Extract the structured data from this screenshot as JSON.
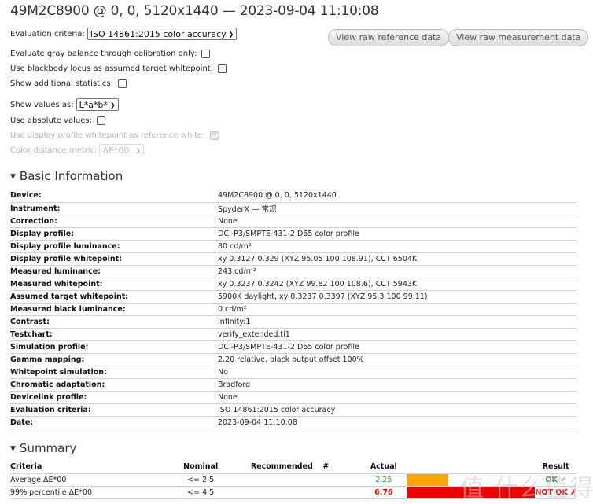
{
  "title": "49M2C8900 @ 0, 0, 5120x1440 — 2023-09-04 11:10:08",
  "options": {
    "evaluation_criteria_label": "Evaluation criteria:",
    "evaluation_criteria_value": "ISO 14861:2015 color accuracy",
    "gray_balance_label": "Evaluate gray balance through calibration only:",
    "blackbody_label": "Use blackbody locus as assumed target whitepoint:",
    "additional_stats_label": "Show additional statistics:",
    "show_values_label": "Show values as:",
    "show_values_value": "L*a*b*",
    "absolute_values_label": "Use absolute values:",
    "display_whitepoint_label": "Use display profile whitepoint as reference white:",
    "color_distance_label": "Color distance metric:",
    "color_distance_value": "ΔE*00"
  },
  "buttons": {
    "raw_reference": "View raw reference data",
    "raw_measurement": "View raw measurement data"
  },
  "basic_info": {
    "heading": "Basic Information",
    "rows": [
      {
        "key": "Device:",
        "value": "49M2C8900 @ 0, 0, 5120x1440"
      },
      {
        "key": "Instrument:",
        "value": "SpyderX — 常规"
      },
      {
        "key": "Correction:",
        "value": "None"
      },
      {
        "key": "Display profile:",
        "value": "DCI-P3/SMPTE-431-2 D65 color profile"
      },
      {
        "key": "Display profile luminance:",
        "value": "80 cd/m²"
      },
      {
        "key": "Display profile whitepoint:",
        "value": "xy 0.3127 0.329 (XYZ 95.05 100 108.91), CCT 6504K"
      },
      {
        "key": "Measured luminance:",
        "value": "243 cd/m²"
      },
      {
        "key": "Measured whitepoint:",
        "value": "xy 0.3237 0.3242 (XYZ 99.82 100 108.6), CCT 5943K"
      },
      {
        "key": "Assumed target whitepoint:",
        "value": "5900K daylight, xy 0.3237 0.3397 (XYZ 95.3 100 99.11)"
      },
      {
        "key": "Measured black luminance:",
        "value": "0 cd/m²"
      },
      {
        "key": "Contrast:",
        "value": "Infinity:1"
      },
      {
        "key": "Testchart:",
        "value": "verify_extended.ti1"
      },
      {
        "key": "Simulation profile:",
        "value": "DCI-P3/SMPTE-431-2 D65 color profile"
      },
      {
        "key": "Gamma mapping:",
        "value": "2.20 relative, black output offset 100%"
      },
      {
        "key": "Whitepoint simulation:",
        "value": "No"
      },
      {
        "key": "Chromatic adaptation:",
        "value": "Bradford"
      },
      {
        "key": "Devicelink profile:",
        "value": "None"
      },
      {
        "key": "Evaluation criteria:",
        "value": "ISO 14861:2015 color accuracy"
      },
      {
        "key": "Date:",
        "value": "2023-09-04 11:10:08"
      }
    ]
  },
  "summary": {
    "heading": "Summary",
    "headers": {
      "criteria": "Criteria",
      "nominal": "Nominal",
      "recommended": "Recommended",
      "hash": "#",
      "actual": "Actual",
      "result": "Result"
    },
    "rows": [
      {
        "criteria": "Average ΔE*00",
        "nominal": "<= 2.5",
        "recommended": "",
        "hash": "",
        "actual": "2.25",
        "actual_color": "#3a9a3a",
        "bar_color": "#ffa500",
        "bar_fraction": 0.22,
        "result": "OK ✓",
        "result_color": "#3a9a3a"
      },
      {
        "criteria": "99% percentile ΔE*00",
        "nominal": "<= 4.5",
        "recommended": "",
        "hash": "",
        "actual": "6.76",
        "actual_color": "#dd0000",
        "bar_color": "#ee0000",
        "bar_fraction": 0.68,
        "result": "NOT OK ✗",
        "result_color": "#dd0000"
      }
    ]
  },
  "watermark": "值 什么值得买"
}
